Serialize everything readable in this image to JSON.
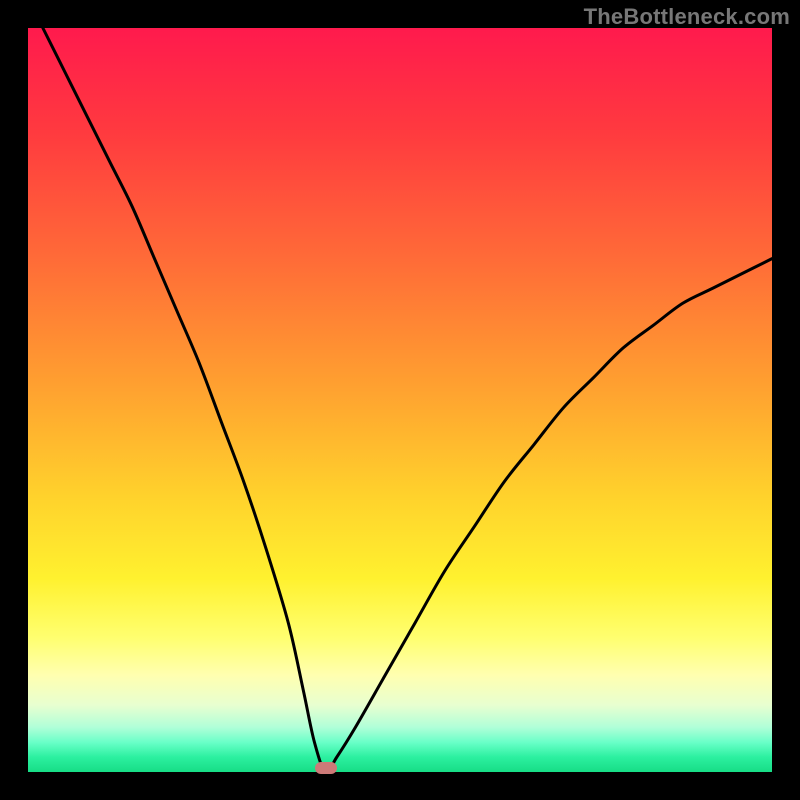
{
  "watermark": "TheBottleneck.com",
  "colors": {
    "frame": "#000000",
    "curve": "#000000",
    "marker": "#cd7a78",
    "gradient_top": "#ff1a4d",
    "gradient_bottom": "#17dd86"
  },
  "chart_data": {
    "type": "line",
    "title": "",
    "xlabel": "",
    "ylabel": "",
    "xlim": [
      0,
      100
    ],
    "ylim": [
      0,
      100
    ],
    "grid": false,
    "legend": false,
    "annotations": [],
    "minimum": {
      "x": 40,
      "y": 0
    },
    "series": [
      {
        "name": "bottleneck-curve",
        "x": [
          2,
          5,
          8,
          11,
          14,
          17,
          20,
          23,
          26,
          29,
          32,
          35,
          37,
          38.5,
          40,
          41.5,
          44,
          48,
          52,
          56,
          60,
          64,
          68,
          72,
          76,
          80,
          84,
          88,
          92,
          96,
          100
        ],
        "values": [
          100,
          94,
          88,
          82,
          76,
          69,
          62,
          55,
          47,
          39,
          30,
          20,
          11,
          4,
          0,
          2,
          6,
          13,
          20,
          27,
          33,
          39,
          44,
          49,
          53,
          57,
          60,
          63,
          65,
          67,
          69
        ]
      }
    ]
  }
}
